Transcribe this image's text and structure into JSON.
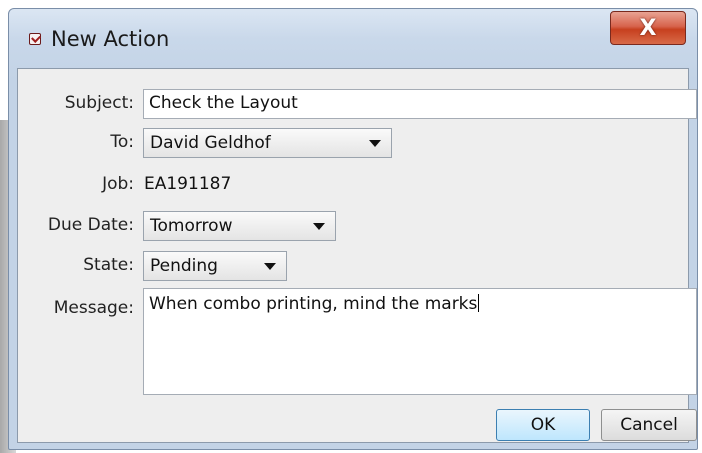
{
  "window": {
    "title": "New Action",
    "close_glyph": "X"
  },
  "form": {
    "subject": {
      "label": "Subject:",
      "value": "Check the Layout"
    },
    "to": {
      "label": "To:",
      "value": "David Geldhof"
    },
    "job": {
      "label": "Job:",
      "value": "EA191187"
    },
    "due_date": {
      "label": "Due Date:",
      "value": "Tomorrow"
    },
    "state": {
      "label": "State:",
      "value": "Pending"
    },
    "message": {
      "label": "Message:",
      "value": "When combo printing, mind the marks"
    }
  },
  "buttons": {
    "ok": "OK",
    "cancel": "Cancel"
  },
  "icons": {
    "title_icon": "checkbox-icon",
    "close_icon": "close-icon",
    "dropdown_icon": "chevron-down-icon"
  },
  "colors": {
    "close_button": "#c7401f",
    "default_button": "#bee6fd",
    "title_bar": "#c9d8ea"
  }
}
